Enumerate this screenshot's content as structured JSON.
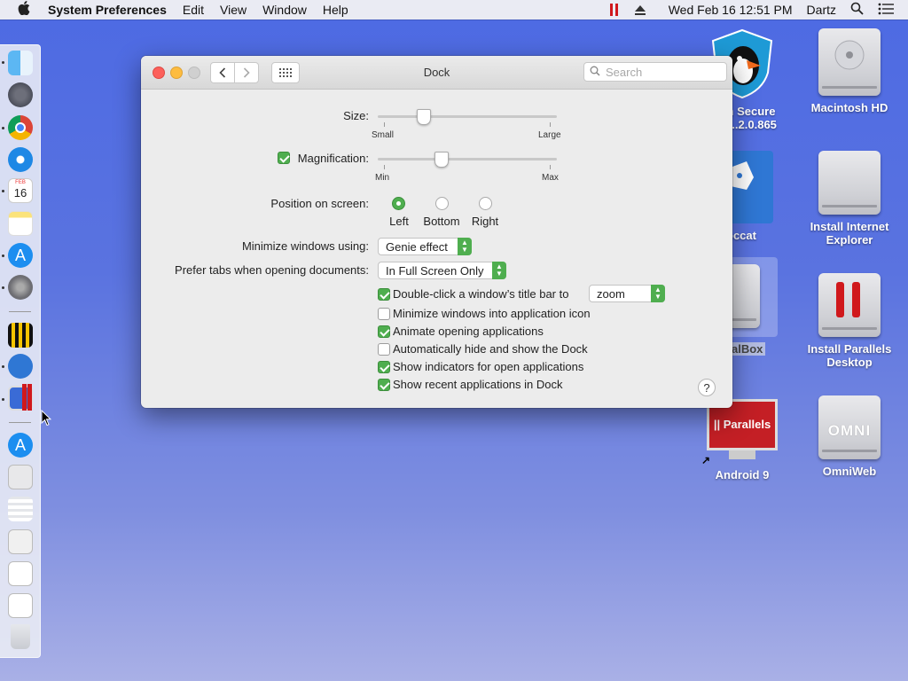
{
  "menubar": {
    "app_name": "System Preferences",
    "menus": [
      "Edit",
      "View",
      "Window",
      "Help"
    ],
    "clock": "Wed Feb 16  12:51 PM",
    "user": "Dartz"
  },
  "desktop": {
    "icons": [
      {
        "label": "n Secure\n....2.0.865"
      },
      {
        "label": "Macintosh HD"
      },
      {
        "label": "occat"
      },
      {
        "label": "Install Internet\nExplorer"
      },
      {
        "label": "alBox"
      },
      {
        "label": "Install Parallels\nDesktop"
      },
      {
        "label": "Android 9"
      },
      {
        "label": "OmniWeb"
      }
    ],
    "parallels_screen_text": "|| Parallels",
    "omni_text": "OMNI"
  },
  "window": {
    "title": "Dock",
    "search_placeholder": "Search",
    "size": {
      "label": "Size:",
      "min_label": "Small",
      "max_label": "Large",
      "value": 0.25
    },
    "magnification": {
      "label": "Magnification:",
      "enabled": true,
      "min_label": "Min",
      "max_label": "Max",
      "value": 0.35
    },
    "position": {
      "label": "Position on screen:",
      "options": [
        "Left",
        "Bottom",
        "Right"
      ],
      "selected": "Left"
    },
    "minimize": {
      "label": "Minimize windows using:",
      "value": "Genie effect"
    },
    "prefer_tabs": {
      "label": "Prefer tabs when opening documents:",
      "value": "In Full Screen Only"
    },
    "checkboxes": [
      {
        "label": "Double-click a window’s title bar to",
        "checked": true
      },
      {
        "label": "Minimize windows into application icon",
        "checked": false
      },
      {
        "label": "Animate opening applications",
        "checked": true
      },
      {
        "label": "Automatically hide and show the Dock",
        "checked": false
      },
      {
        "label": "Show indicators for open applications",
        "checked": true
      },
      {
        "label": "Show recent applications in Dock",
        "checked": true
      }
    ],
    "double_click_action": "zoom",
    "help": "?"
  },
  "dock": {
    "calendar_month": "FEB",
    "calendar_day": "16"
  },
  "colors": {
    "accent": "#4fae4f",
    "desktop_top": "#4d6ae3",
    "parallels_red": "#d0181c"
  }
}
